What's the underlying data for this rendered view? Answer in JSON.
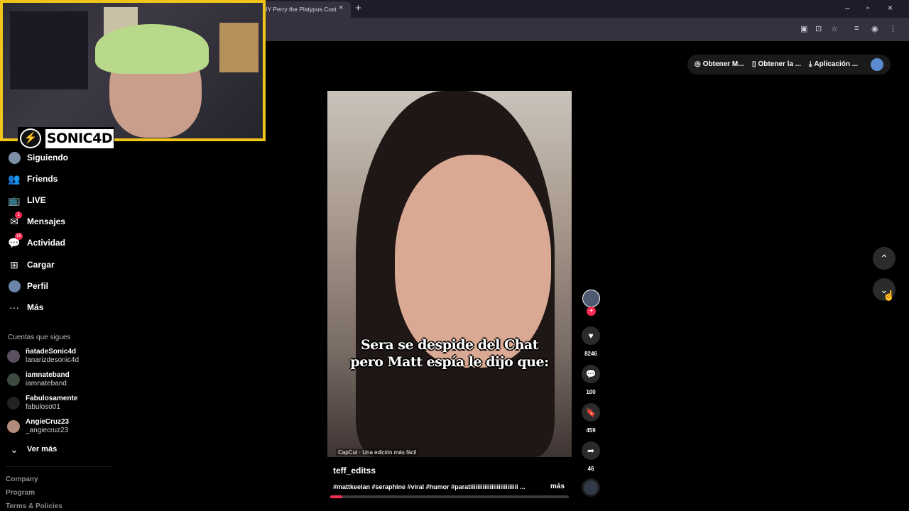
{
  "browser": {
    "tab_title": "DIY Perry the Platypus Cost",
    "tab_close": "×",
    "new_tab": "+",
    "window_controls": [
      "–",
      "▫",
      "×"
    ],
    "toolbar_icons": [
      "screen-share-icon",
      "translate-icon",
      "star-icon",
      "media-icon",
      "extension-icon",
      "menu-icon"
    ]
  },
  "streamer": {
    "name": "SONIC4D",
    "logo": "⚡",
    "frame_color": "#f0c419"
  },
  "sidebar": {
    "items": [
      {
        "label": "Siguiendo",
        "icon": "avatar-icon"
      },
      {
        "label": "Friends",
        "icon": "friends-icon",
        "glyph": "👥"
      },
      {
        "label": "LIVE",
        "icon": "live-icon",
        "glyph": "📺"
      },
      {
        "label": "Mensajes",
        "icon": "messages-icon",
        "glyph": "✉",
        "badge": "1"
      },
      {
        "label": "Actividad",
        "icon": "activity-icon",
        "glyph": "💬",
        "badge": "16"
      },
      {
        "label": "Cargar",
        "icon": "upload-icon",
        "glyph": "⊞"
      },
      {
        "label": "Perfil",
        "icon": "profile-icon"
      },
      {
        "label": "Más",
        "icon": "more-icon",
        "glyph": "···"
      }
    ],
    "following_title": "Cuentas que sigues",
    "accounts": [
      {
        "name": "ñatadeSonic4d",
        "handle": "lanarizdesonic4d"
      },
      {
        "name": "iamnateband",
        "handle": "iamnateband"
      },
      {
        "name": "Fabulosamente",
        "handle": "fabuloso01"
      },
      {
        "name": "AngieCruz23",
        "handle": "_angiecruz23"
      }
    ],
    "see_more": "Ver más",
    "see_more_glyph": "⌄",
    "footer": [
      "Company",
      "Program",
      "Terms & Policies"
    ]
  },
  "top_actions": [
    {
      "label": "Obtener M...",
      "glyph": "◎"
    },
    {
      "label": "Obtener la ...",
      "glyph": "▯"
    },
    {
      "label": "Aplicación ...",
      "glyph": "⤓"
    }
  ],
  "video": {
    "caption_line1": "Sera se despide del Chat",
    "caption_line2": "pero Matt espía le dijo que:",
    "capcut_label": "CapCut · Una edición más fácil",
    "author": "teff_editss",
    "description": "#mattkeelan #seraphine #viral #humor #paratiiiiiiiiiiiiiiiiiiiiiiiiiii ...",
    "more_label": "más",
    "progress": 0.05
  },
  "actions": {
    "follow_glyph": "+",
    "like": {
      "glyph": "♥",
      "count": "8246"
    },
    "comment": {
      "glyph": "💬",
      "count": "100"
    },
    "save": {
      "glyph": "🔖",
      "count": "459"
    },
    "share": {
      "glyph": "➦",
      "count": "46"
    }
  },
  "scroll_nav": {
    "up": "⌃",
    "down": "⌄",
    "cursor": "☝"
  },
  "colors": {
    "accent": "#fe2c55",
    "sidebar_bg": "#000000"
  }
}
